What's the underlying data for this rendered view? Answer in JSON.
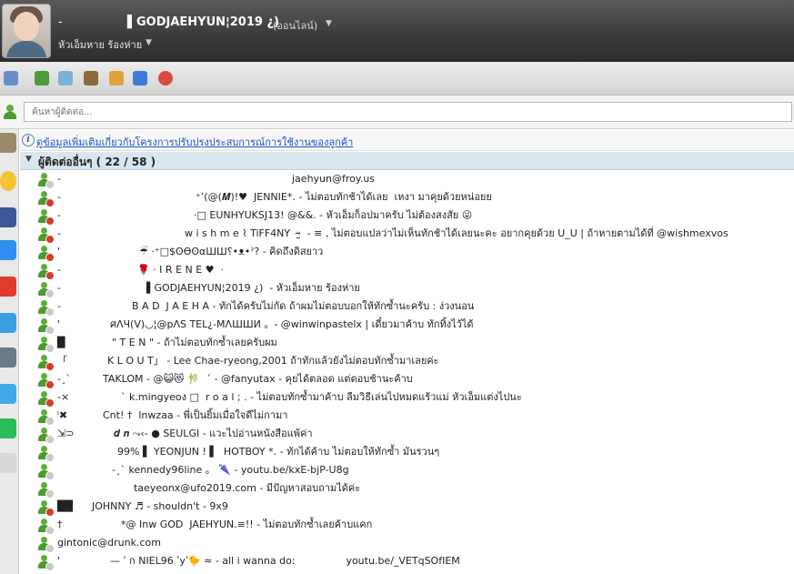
{
  "user": {
    "display_name": "▌GODJAEHYUN¦2019 ¿)",
    "prefix": "-",
    "status": "(ออนไลน์)",
    "personal_message": "หัวเอ็มหาย ร้องห่าย"
  },
  "search": {
    "placeholder": "ค้นหาผู้ติดต่อ..."
  },
  "info_bar": {
    "text": "ดูข้อมูลเพิ่มเติมเกี่ยวกับโครงการปรับปรุงประสบการณ์การใช้งานของลูกค้า"
  },
  "group": {
    "title": "ผู้ติดต่ออื่นๆ ( 22 / 58 )"
  },
  "colors": {
    "header_bg": "#3c3c3c",
    "group_bg": "#d9e6ef",
    "link": "#1f4fd0",
    "busy": "#d83b28",
    "online": "#4d9a2e"
  },
  "contacts": [
    {
      "prefix": "-",
      "text": "jaehyun@froy.us",
      "badge": "away"
    },
    {
      "prefix": "-",
      "text": "⁺’(@(𝑴)!♥  JENNIE*. - ไม่ตอบทักช้าได้เลย  เหงา มาคุยด้วยหน่อยย",
      "badge": "busy"
    },
    {
      "prefix": "-",
      "text": "·□ EUNHYUKSJ13! @&&. - หัวเอ็มก็อปมาครับ ไม่ต้องสงสัย 😜",
      "badge": "busy"
    },
    {
      "prefix": "-",
      "text": "w i s h m e ⌇ TiFF4NY  ᵕ̴̫  - ≡ , ไม่ตอบแปลว่าไม่เห็นทักช้าได้เลยนะคะ อยากคุยด้วย U_U | ถ้าหายตามได้ที่ @wishmexvos",
      "badge": "busy"
    },
    {
      "prefix": "'",
      "text": "☔ ·⁺□$ʘϴʘαШШ⸮•ᴥ•ˀ? - คิดถึงดิสยาว",
      "badge": "busy"
    },
    {
      "prefix": "-",
      "text": "🌹 · I R E N E ♥  ·",
      "badge": "busy"
    },
    {
      "prefix": "-",
      "text": "▌GODJAEHYUN¦2019 ¿)  - หัวเอ็มหาย ร้องห่าย",
      "badge": "away"
    },
    {
      "prefix": "-",
      "text": "B A D  J A E H A - ทักได้ครับไม่กัด ถ้าผมไม่ตอบบอกให้ทักซ้ำนะครับ : ง่วงนอน",
      "badge": "away"
    },
    {
      "prefix": "'",
      "text": "ศΛЧ(V)◡¦@pΛS TEL¿-MΛШШИ 。- @winwinpastelx | เดี๋ยวมาค้าบ ทักทิ้งไว้ได้",
      "badge": "away"
    },
    {
      "prefix": "█",
      "text": "\" T E N \" - ถ้าไม่ตอบทักซ้ำเลยครับผม",
      "badge": "away"
    },
    {
      "prefix": "「",
      "text": "K L O U T」 - Lee Chae-ryeong,2001 ถ้าทักแล้วยังไม่ตอบทักซ้ำมาเลยค่ะ",
      "badge": "busy"
    },
    {
      "prefix": "-¸`",
      "text": "TAKLOM - @😺😻 🎋  ´ - @fanyutax - คุยได้ตลอด แต่ตอบช้านะค้าบ",
      "badge": "busy"
    },
    {
      "prefix": "-×",
      "text": "` k.mingyeoง □  r o a l ; . - ไม่ตอบทักซ้ำมาค้าบ ลืมวิธีเล่นไปหมดแร้วแม่ หัวเอ็มแต่งไปนะ",
      "badge": "busy"
    },
    {
      "prefix": "ˡ✖",
      "text": "Cnt! †  lnwzaa - พี่เป็นยิ้มเมื่อใจดีไม่กามา",
      "badge": "away"
    },
    {
      "prefix": "⇲⊃",
      "text": "𝒅 𝒏 ⤳‹- ● SEULGI - แวะไปอ่านหนังสือแพ้ค่า",
      "badge": "away"
    },
    {
      "prefix": "",
      "text": "99% ▌ YEONJUN ! ▌  HOTBOY *. - ทักได้ค้าบ ไม่ตอบให้ทักซ้ำ มันรวนๆ",
      "badge": "away"
    },
    {
      "prefix": "",
      "text": "-¸` kennedy96line 。 🌂 - youtu.be/kxE-bjP-U8g",
      "badge": "away"
    },
    {
      "prefix": "",
      "text": "taeyeonx@ufo2019.com - มีปัญหาสอบถามได้ค่ะ",
      "badge": "away"
    },
    {
      "prefix": "██",
      "text": "JOHNNY ♬ - shouldn't - 9x9",
      "badge": "busy"
    },
    {
      "prefix": "†",
      "text": "*@ Inw GOD  JAEHYUN.≡!! - ไม่ตอบทักซ้ำเลยค้าบแคก",
      "badge": "away"
    },
    {
      "prefix": "",
      "text": "gintonic@drunk.com",
      "badge": "away"
    },
    {
      "prefix": "'",
      "text": "— ʹ ก NIEL96 ʹyʹ🐤 ≈ - all i wanna do:                youtu.be/_VETqSOfIEM",
      "badge": "away"
    }
  ]
}
